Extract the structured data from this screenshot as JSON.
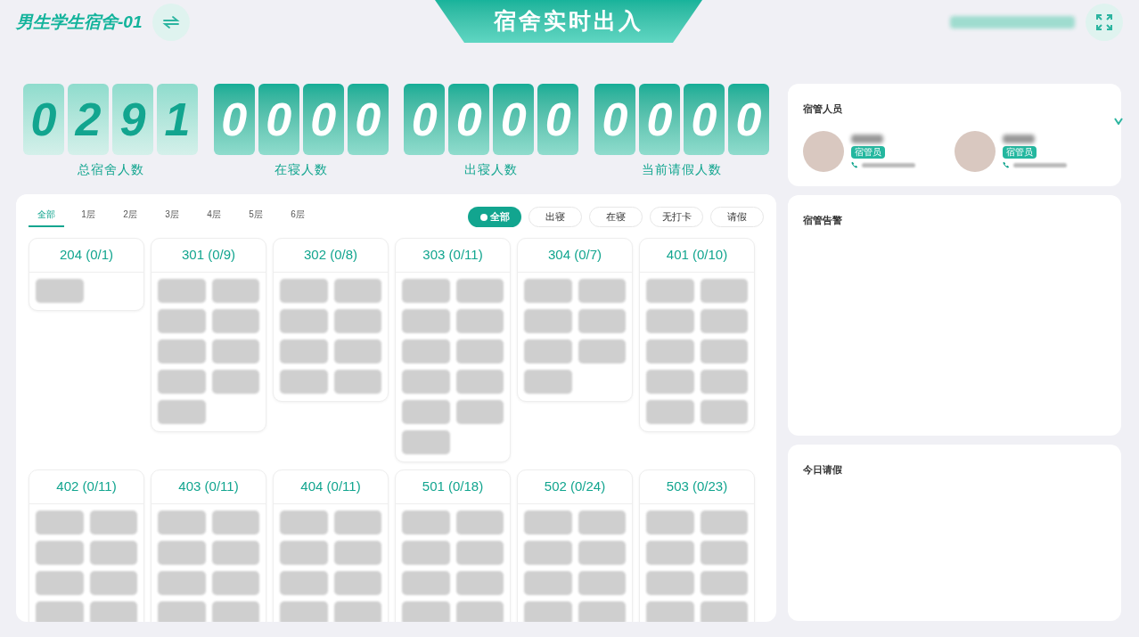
{
  "header": {
    "building": "男生学生宿舍-01",
    "title": "宿舍实时出入",
    "datetime_redacted": true
  },
  "stats": [
    {
      "label": "总宿舍人数",
      "kind": "light",
      "digits": [
        "0",
        "2",
        "9",
        "1"
      ]
    },
    {
      "label": "在寝人数",
      "kind": "dark",
      "digits": [
        "0",
        "0",
        "0",
        "0"
      ]
    },
    {
      "label": "出寝人数",
      "kind": "dark",
      "digits": [
        "0",
        "0",
        "0",
        "0"
      ]
    },
    {
      "label": "当前请假人数",
      "kind": "dark",
      "digits": [
        "0",
        "0",
        "0",
        "0"
      ]
    }
  ],
  "floor_tabs": [
    {
      "label": "全部",
      "selected": true
    },
    {
      "label": "1层",
      "selected": false
    },
    {
      "label": "2层",
      "selected": false
    },
    {
      "label": "3层",
      "selected": false
    },
    {
      "label": "4层",
      "selected": false
    },
    {
      "label": "5层",
      "selected": false
    },
    {
      "label": "6层",
      "selected": false
    }
  ],
  "status_filters": [
    {
      "label": "全部",
      "selected": true
    },
    {
      "label": "出寝",
      "selected": false
    },
    {
      "label": "在寝",
      "selected": false
    },
    {
      "label": "无打卡",
      "selected": false
    },
    {
      "label": "请假",
      "selected": false
    }
  ],
  "rooms": [
    {
      "title": "204 (0/1)",
      "chips": [
        {
          "redacted": true
        }
      ]
    },
    {
      "title": "301 (0/9)",
      "chips": [
        {
          "redacted": true
        },
        {
          "redacted": true
        },
        {
          "redacted": true
        },
        {
          "redacted": true
        },
        {
          "redacted": true
        },
        {
          "redacted": true
        },
        {
          "redacted": true
        },
        {
          "redacted": true
        },
        {
          "redacted": true
        }
      ]
    },
    {
      "title": "302 (0/8)",
      "chips": [
        {
          "redacted": true
        },
        {
          "redacted": true
        },
        {
          "redacted": true
        },
        {
          "redacted": true
        },
        {
          "redacted": true
        },
        {
          "redacted": true
        },
        {
          "redacted": true
        },
        {
          "redacted": true
        }
      ]
    },
    {
      "title": "303 (0/11)",
      "chips": [
        {
          "redacted": true
        },
        {
          "redacted": true
        },
        {
          "redacted": true
        },
        {
          "redacted": true
        },
        {
          "redacted": true
        },
        {
          "redacted": true
        },
        {
          "redacted": true
        },
        {
          "redacted": true
        },
        {
          "redacted": true
        },
        {
          "redacted": true
        },
        {
          "redacted": true
        }
      ]
    },
    {
      "title": "304 (0/7)",
      "chips": [
        {
          "redacted": true
        },
        {
          "redacted": true
        },
        {
          "redacted": true
        },
        {
          "redacted": true
        },
        {
          "redacted": true
        },
        {
          "redacted": true
        },
        {
          "redacted": true
        }
      ]
    },
    {
      "title": "401 (0/10)",
      "chips": [
        {
          "redacted": true
        },
        {
          "redacted": true
        },
        {
          "redacted": true
        },
        {
          "redacted": true
        },
        {
          "redacted": true
        },
        {
          "redacted": true
        },
        {
          "redacted": true
        },
        {
          "redacted": true
        },
        {
          "redacted": true
        },
        {
          "redacted": true
        }
      ]
    },
    {
      "title": "402 (0/11)",
      "chips": [
        {
          "redacted": true
        },
        {
          "redacted": true
        },
        {
          "redacted": true
        },
        {
          "redacted": true
        },
        {
          "redacted": true
        },
        {
          "redacted": true
        },
        {
          "redacted": true
        },
        {
          "redacted": true
        }
      ]
    },
    {
      "title": "403 (0/11)",
      "chips": [
        {
          "redacted": true
        },
        {
          "redacted": true
        },
        {
          "redacted": true
        },
        {
          "redacted": true
        },
        {
          "redacted": true
        },
        {
          "redacted": true
        },
        {
          "redacted": true
        },
        {
          "redacted": true
        }
      ]
    },
    {
      "title": "404 (0/11)",
      "chips": [
        {
          "redacted": true
        },
        {
          "redacted": true
        },
        {
          "redacted": true
        },
        {
          "redacted": true
        },
        {
          "redacted": true
        },
        {
          "redacted": true
        },
        {
          "redacted": true
        },
        {
          "redacted": true
        }
      ]
    },
    {
      "title": "501 (0/18)",
      "chips": [
        {
          "redacted": true
        },
        {
          "redacted": true
        },
        {
          "redacted": true
        },
        {
          "redacted": true
        },
        {
          "redacted": true
        },
        {
          "redacted": true
        },
        {
          "redacted": true
        },
        {
          "redacted": true
        }
      ]
    },
    {
      "title": "502 (0/24)",
      "chips": [
        {
          "redacted": true
        },
        {
          "redacted": true
        },
        {
          "redacted": true
        },
        {
          "redacted": true
        },
        {
          "redacted": true
        },
        {
          "redacted": true
        },
        {
          "redacted": true
        },
        {
          "redacted": true
        }
      ]
    },
    {
      "title": "503 (0/23)",
      "chips": [
        {
          "redacted": true
        },
        {
          "redacted": true
        },
        {
          "redacted": true
        },
        {
          "redacted": true
        },
        {
          "redacted": true
        },
        {
          "redacted": true
        },
        {
          "redacted": true
        },
        {
          "redacted": true
        }
      ]
    }
  ],
  "staff_panel": {
    "title": "宿管人员",
    "people": [
      {
        "role": "宿管员",
        "redacted": true
      },
      {
        "role": "宿管员",
        "redacted": true
      }
    ]
  },
  "alerts_panel": {
    "title": "宿管告警"
  },
  "leave_panel": {
    "title": "今日请假"
  }
}
